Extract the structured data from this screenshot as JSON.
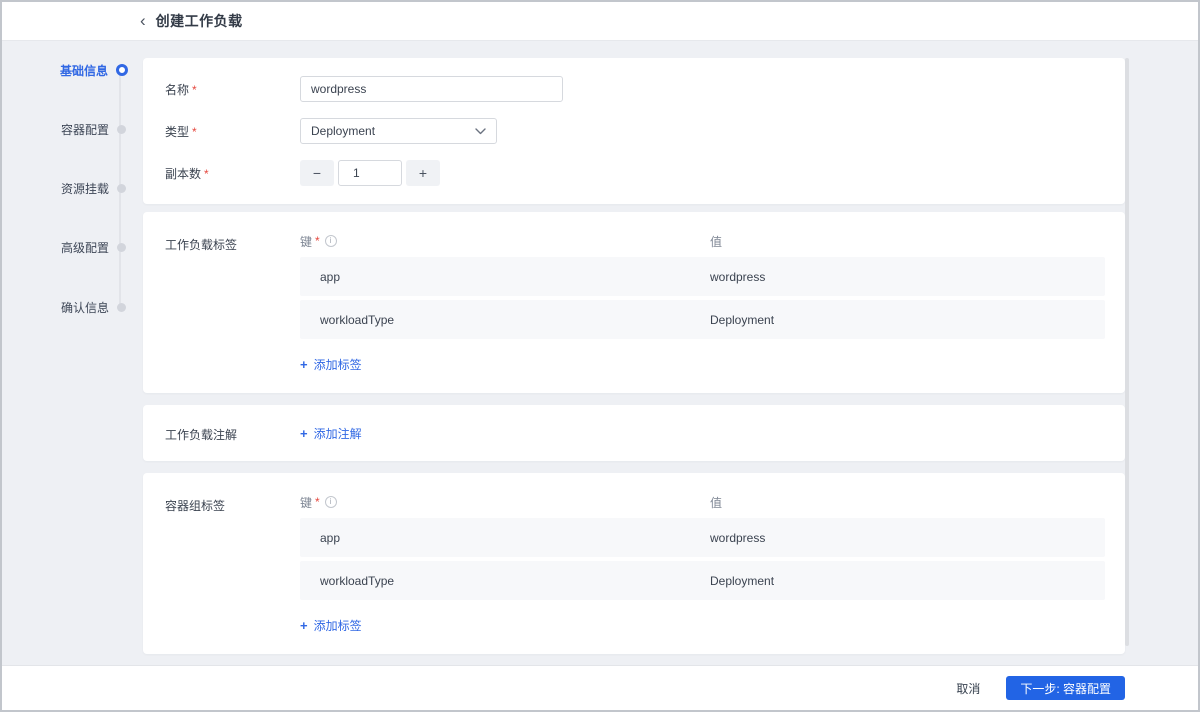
{
  "header": {
    "title": "创建工作负载"
  },
  "icons": {
    "back": "‹",
    "plus": "+",
    "minus": "−",
    "stepper_plus": "+",
    "info": "i"
  },
  "misc": {
    "required_mark": "*"
  },
  "steps": [
    {
      "label": "基础信息",
      "active": true
    },
    {
      "label": "容器配置",
      "active": false
    },
    {
      "label": "资源挂载",
      "active": false
    },
    {
      "label": "高级配置",
      "active": false
    },
    {
      "label": "确认信息",
      "active": false
    }
  ],
  "basic_form": {
    "name_label": "名称",
    "name_value": "wordpress",
    "type_label": "类型",
    "type_value": "Deployment",
    "replicas_label": "副本数",
    "replicas_value": "1"
  },
  "workload_labels": {
    "section_label": "工作负载标签",
    "key_header": "键",
    "value_header": "值",
    "rows": [
      {
        "key": "app",
        "value": "wordpress"
      },
      {
        "key": "workloadType",
        "value": "Deployment"
      }
    ],
    "add_label": "添加标签"
  },
  "workload_annotations": {
    "section_label": "工作负载注解",
    "add_label": "添加注解"
  },
  "pod_labels": {
    "section_label": "容器组标签",
    "key_header": "键",
    "value_header": "值",
    "rows": [
      {
        "key": "app",
        "value": "wordpress"
      },
      {
        "key": "workloadType",
        "value": "Deployment"
      }
    ],
    "add_label": "添加标签"
  },
  "footer": {
    "cancel_label": "取消",
    "next_label": "下一步: 容器配置"
  },
  "colors": {
    "accent_blue": "#2264e5",
    "link_blue": "#3168e4",
    "content_bg": "#eef0f4",
    "row_bg": "#f7f8fa",
    "required_red": "#e5483f"
  }
}
